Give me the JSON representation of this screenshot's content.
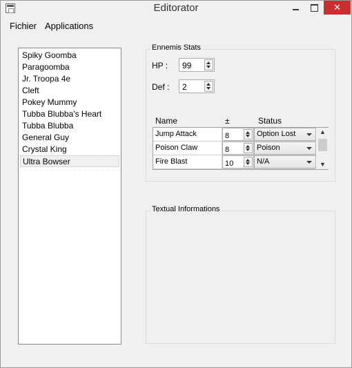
{
  "window": {
    "title": "Editorator",
    "close_symbol": "✕"
  },
  "menubar": {
    "items": [
      "Fichier",
      "Applications"
    ]
  },
  "enemies": {
    "items": [
      "Spiky Goomba",
      "Paragoomba",
      "Jr. Troopa 4e",
      "Cleft",
      "Pokey Mummy",
      "Tubba Blubba's Heart",
      "Tubba Blubba",
      "General Guy",
      "Crystal King",
      "Ultra Bowser"
    ],
    "selected": "Ultra Bowser"
  },
  "stats": {
    "group_title": "Ennemis Stats",
    "hp_label": "HP :",
    "hp_value": "99",
    "def_label": "Def :",
    "def_value": "2"
  },
  "moves": {
    "headers": [
      "Name",
      "±",
      "Status"
    ],
    "rows": [
      {
        "name": "Jump Attack",
        "amount": "8",
        "status": "Option Lost"
      },
      {
        "name": "Poison Claw",
        "amount": "8",
        "status": "Poison"
      },
      {
        "name": "Fire Blast",
        "amount": "10",
        "status": "N/A"
      }
    ]
  },
  "textual": {
    "group_title": "Textual Informations"
  },
  "colors": {
    "close_button": "#c7302e",
    "window_bg": "#f0f0f0"
  },
  "icons": {
    "app": "app-icon",
    "minimize": "minimize-icon",
    "maximize": "maximize-icon",
    "close": "close-icon"
  }
}
